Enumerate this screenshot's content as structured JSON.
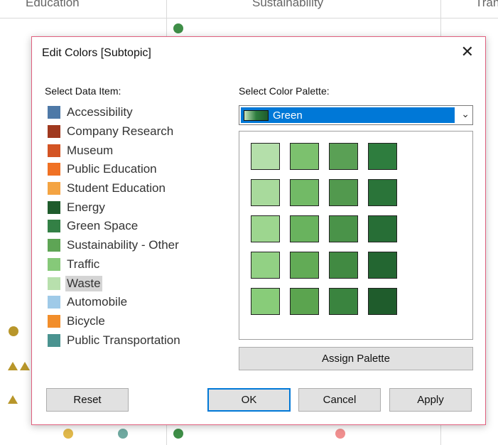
{
  "background": {
    "columns": [
      "Education",
      "Sustainability",
      "Tran"
    ]
  },
  "dialog": {
    "title": "Edit Colors [Subtopic]",
    "close_icon": "close-icon",
    "select_data_item_label": "Select Data Item:",
    "select_palette_label": "Select Color Palette:",
    "items": [
      {
        "label": "Accessibility",
        "color": "#4e79a7"
      },
      {
        "label": "Company Research",
        "color": "#a0391f"
      },
      {
        "label": "Museum",
        "color": "#d35424"
      },
      {
        "label": "Public Education",
        "color": "#f07124"
      },
      {
        "label": "Student Education",
        "color": "#f4a443"
      },
      {
        "label": "Energy",
        "color": "#1f5c2c"
      },
      {
        "label": "Green Space",
        "color": "#338045"
      },
      {
        "label": "Sustainability - Other",
        "color": "#5ea555"
      },
      {
        "label": "Traffic",
        "color": "#86c979"
      },
      {
        "label": "Waste",
        "color": "#b8e0ad",
        "selected": true
      },
      {
        "label": "Automobile",
        "color": "#9fcae8"
      },
      {
        "label": "Bicycle",
        "color": "#f28e2b"
      },
      {
        "label": "Public Transportation",
        "color": "#4a9390"
      }
    ],
    "palette": {
      "selected": "Green",
      "colors": [
        "#b4dfaa",
        "#7cc16e",
        "#5aa055",
        "#2e7d3e",
        "#a8da9c",
        "#72ba66",
        "#52994e",
        "#2a7439",
        "#9dd68f",
        "#69b35e",
        "#4a9349",
        "#276e36",
        "#92d184",
        "#62ab56",
        "#418a42",
        "#236631",
        "#88cc79",
        "#5ba44f",
        "#3a843f",
        "#1f5c2c"
      ]
    },
    "buttons": {
      "assign_palette": "Assign Palette",
      "reset": "Reset",
      "ok": "OK",
      "cancel": "Cancel",
      "apply": "Apply"
    }
  }
}
